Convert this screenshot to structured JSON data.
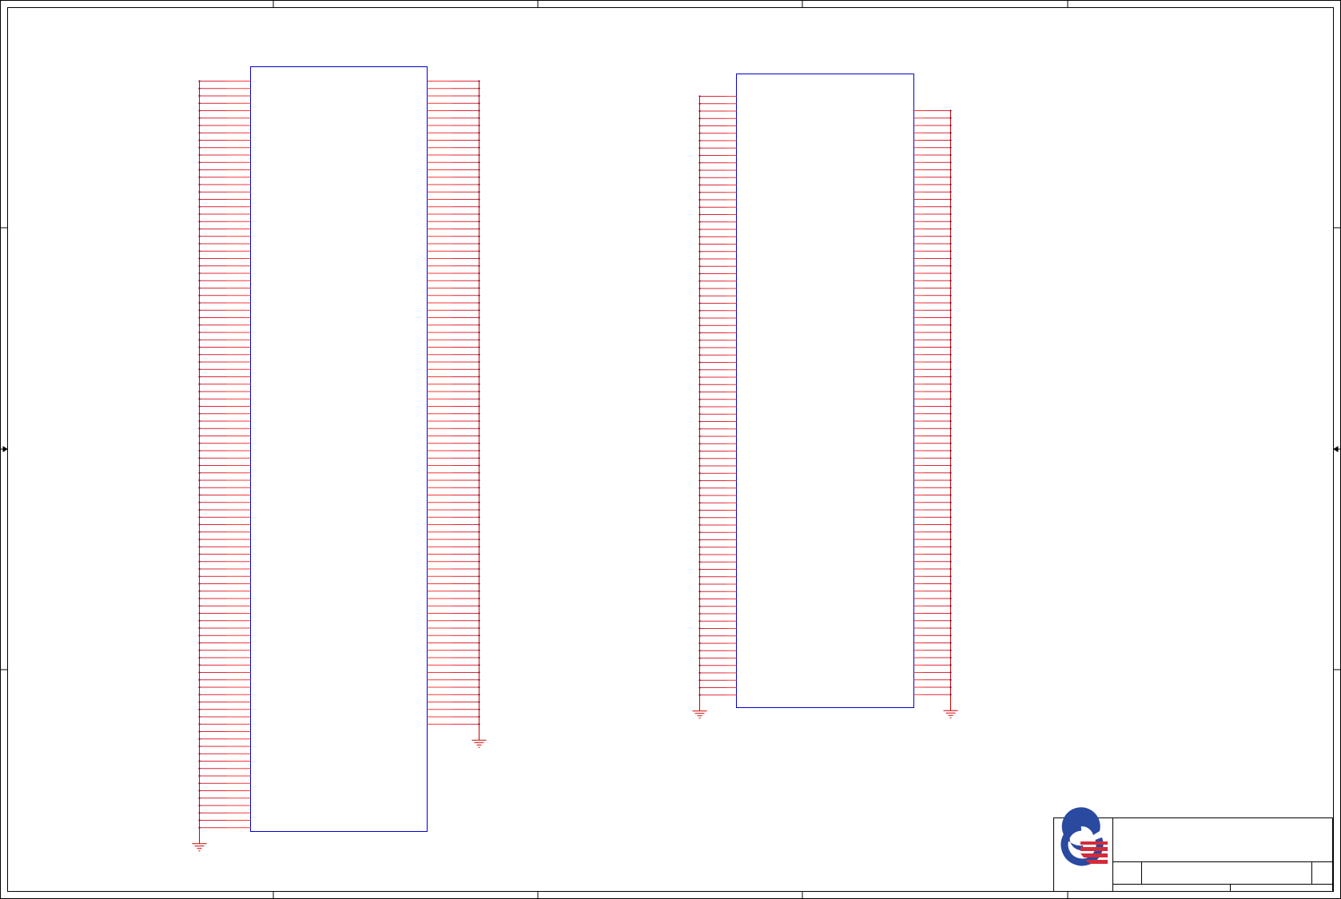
{
  "sheet": {
    "border_color": "#000000",
    "grid_columns": 5,
    "grid_rows": 4
  },
  "colors": {
    "wire": "#cc0000",
    "pin": "#ff3333",
    "bus_dot": "#800040",
    "component_outline": "#0000cc",
    "ground": "#cc0000",
    "logo_blue": "#2a4aa0",
    "logo_red": "#d42b3a"
  },
  "components": [
    {
      "id": "U1",
      "left_pins": 102,
      "right_pins": 88,
      "left_ground": true,
      "right_ground": true
    },
    {
      "id": "U2",
      "left_pins": 82,
      "right_pins": 80,
      "left_ground": true,
      "right_ground": true
    }
  ],
  "title_block": {
    "logo": "company-logo-icon"
  }
}
